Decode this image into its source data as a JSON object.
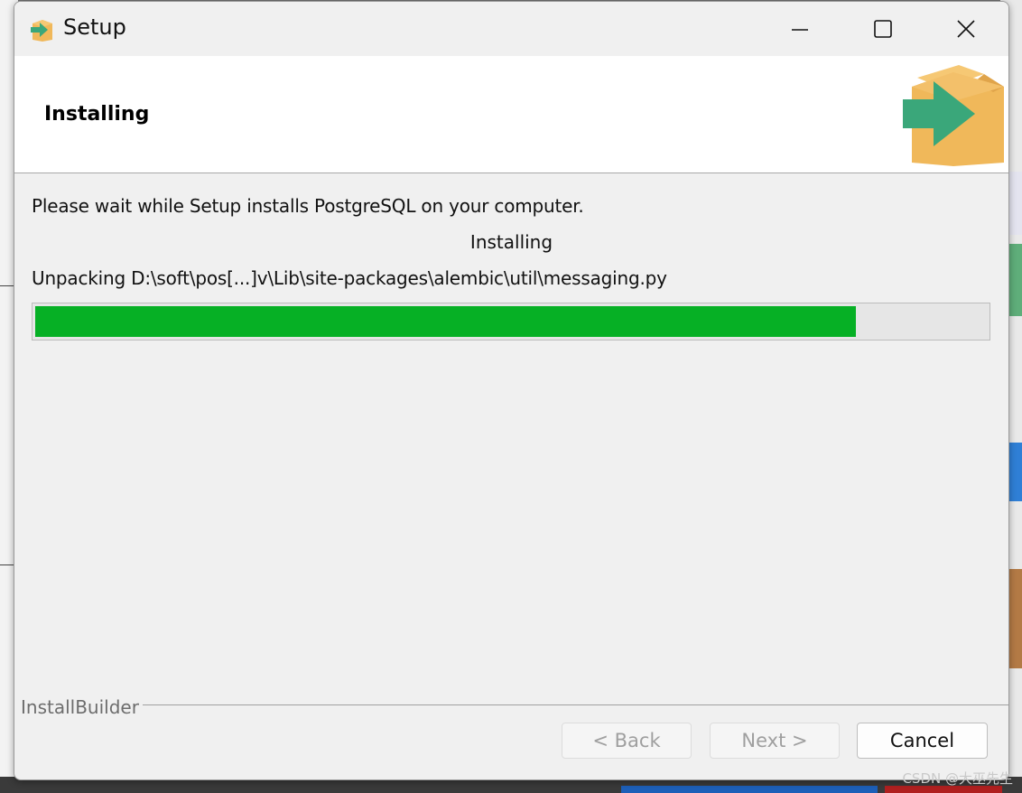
{
  "window": {
    "title": "Setup",
    "controls": {
      "minimize_icon": "minimize-icon",
      "maximize_icon": "maximize-icon",
      "close_icon": "close-icon"
    }
  },
  "header": {
    "title": "Installing",
    "logo_icon": "installer-box-arrow-icon"
  },
  "content": {
    "message": "Please wait while Setup installs PostgreSQL on your computer.",
    "status": "Installing",
    "detail": "Unpacking D:\\soft\\pos[...]v\\Lib\\site-packages\\alembic\\util\\messaging.py",
    "progress": 0.862
  },
  "footer": {
    "brand": "InstallBuilder",
    "buttons": {
      "back": "< Back",
      "next": "Next >",
      "cancel": "Cancel"
    }
  },
  "watermark": "CSDN @大巫先生",
  "colors": {
    "progress_fill": "#06b025",
    "progress_track": "#e6e6e6",
    "header_bg": "#ffffff",
    "window_bg": "#f0f0f0"
  }
}
